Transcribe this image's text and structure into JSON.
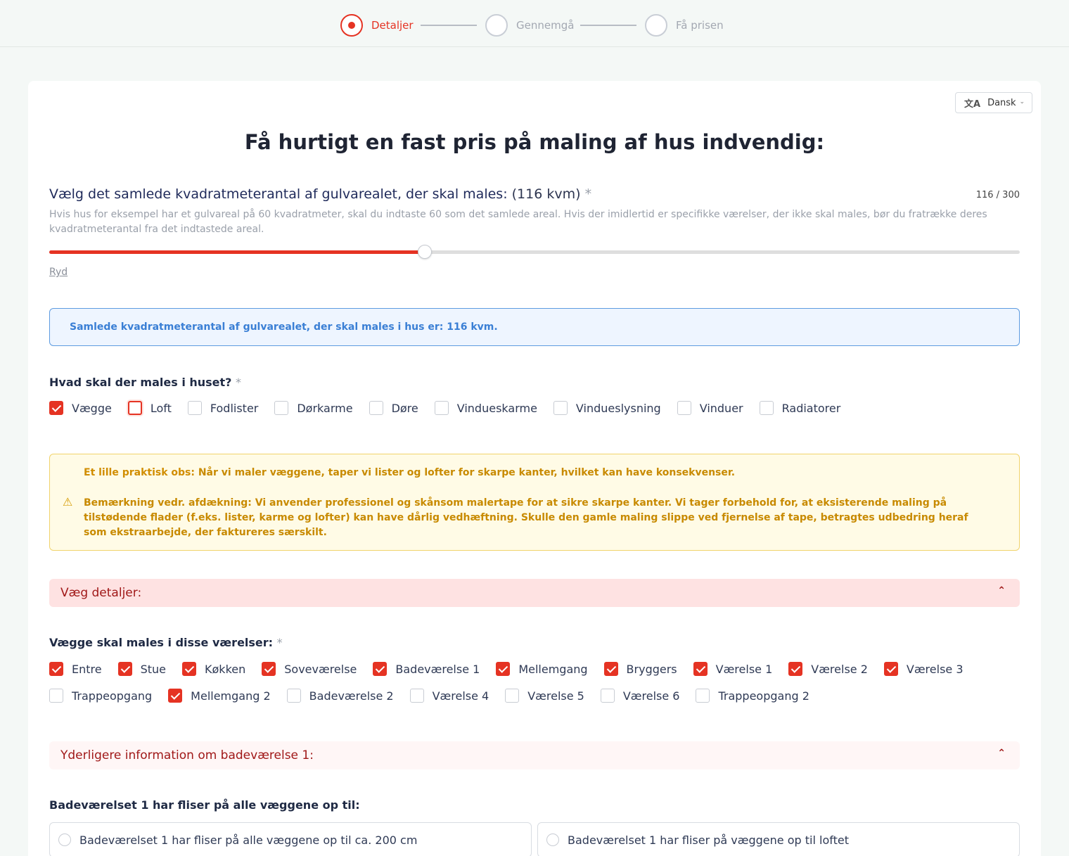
{
  "stepper": {
    "steps": [
      {
        "label": "Detaljer",
        "active": true
      },
      {
        "label": "Gennemgå",
        "active": false
      },
      {
        "label": "Få prisen",
        "active": false
      }
    ]
  },
  "language": {
    "icon": "translate-icon",
    "label": "Dansk"
  },
  "title": "Få hurtigt en fast pris på maling af hus indvendig:",
  "area": {
    "question": "Vælg det samlede kvadratmeterantal af gulvarealet, der skal males: ",
    "value_text": "(116 kvm)",
    "required": "*",
    "counter": "116 / 300",
    "value": 116,
    "max": 300,
    "hint": "Hvis hus for eksempel har et gulvareal på 60 kvadratmeter, skal du indtaste 60 som det samlede areal. Hvis der imidlertid er specifikke værelser, der ikke skal males, bør du fratrække deres kvadratmeterantal fra det indtastede areal.",
    "clear": "Ryd"
  },
  "info_box": "Samlede kvadratmeterantal af gulvarealet, der skal males i hus er: 116 kvm.",
  "paint_question": {
    "label": "Hvad skal der males i huset? ",
    "required": "*"
  },
  "paint_options": [
    {
      "label": "Vægge",
      "checked": true
    },
    {
      "label": "Loft",
      "checked": false,
      "focus": true
    },
    {
      "label": "Fodlister",
      "checked": false
    },
    {
      "label": "Dørkarme",
      "checked": false
    },
    {
      "label": "Døre",
      "checked": false
    },
    {
      "label": "Vindueskarme",
      "checked": false
    },
    {
      "label": "Vindueslysning",
      "checked": false
    },
    {
      "label": "Vinduer",
      "checked": false
    },
    {
      "label": "Radiatorer",
      "checked": false
    }
  ],
  "warning": {
    "line1_prefix": "Et lille praktisk obs:",
    "line1_text": " Når vi maler væggene, taper vi lister og lofter for skarpe kanter, hvilket kan have konsekvenser.",
    "line2": "Bemærkning vedr. afdækning: Vi anvender professionel og skånsom malertape for at sikre skarpe kanter. Vi tager forbehold for, at eksisterende maling på tilstødende flader (f.eks. lister, karme og lofter) kan have dårlig vedhæftning. Skulle den gamle maling slippe ved fjernelse af tape, betragtes udbedring heraf som ekstraarbejde, der faktureres særskilt.",
    "icon": "warning-icon"
  },
  "wall_details": {
    "label": "Væg detaljer:",
    "icon": "chevron-up-icon"
  },
  "rooms_question": {
    "label": "Vægge skal males i disse værelser: ",
    "required": "*"
  },
  "rooms_row1": [
    {
      "label": "Entre",
      "checked": true
    },
    {
      "label": "Stue",
      "checked": true
    },
    {
      "label": "Køkken",
      "checked": true
    },
    {
      "label": "Soveværelse",
      "checked": true
    },
    {
      "label": "Badeværelse 1",
      "checked": true
    },
    {
      "label": "Mellemgang",
      "checked": true
    },
    {
      "label": "Bryggers",
      "checked": true
    },
    {
      "label": "Værelse 1",
      "checked": true
    },
    {
      "label": "Værelse 2",
      "checked": true
    },
    {
      "label": "Værelse 3",
      "checked": true
    }
  ],
  "rooms_row2": [
    {
      "label": "Trappeopgang",
      "checked": false
    },
    {
      "label": "Mellemgang 2",
      "checked": true
    },
    {
      "label": "Badeværelse 2",
      "checked": false
    },
    {
      "label": "Værelse 4",
      "checked": false
    },
    {
      "label": "Værelse 5",
      "checked": false
    },
    {
      "label": "Værelse 6",
      "checked": false
    },
    {
      "label": "Trappeopgang 2",
      "checked": false
    }
  ],
  "bath_details": {
    "label": "Yderligere information om badeværelse 1:",
    "icon": "chevron-up-icon"
  },
  "tiles_question": "Badeværelset 1 har fliser på alle væggene op til:",
  "tiles_options": [
    "Badeværelset 1 har fliser på alle væggene op til ca. 200 cm",
    "Badeværelset 1 har fliser på væggene op til loftet"
  ]
}
